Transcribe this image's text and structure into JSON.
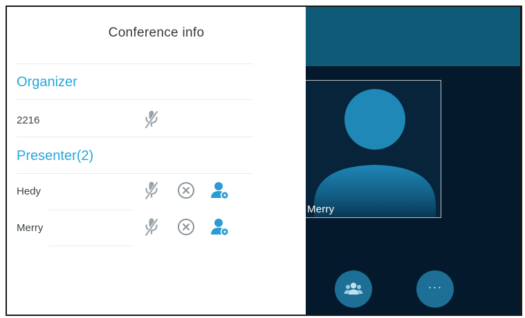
{
  "panel": {
    "title": "Conference info",
    "sections": [
      {
        "header": "Organizer",
        "members": [
          {
            "name": "2216",
            "icons": [
              "mute-microphone-icon"
            ]
          }
        ]
      },
      {
        "header": "Presenter(2)",
        "members": [
          {
            "name": "Hedy",
            "icons": [
              "mute-microphone-icon",
              "remove-circle-icon",
              "presenter-settings-icon"
            ]
          },
          {
            "name": "Merry",
            "icons": [
              "mute-microphone-icon",
              "remove-circle-icon",
              "presenter-settings-icon"
            ]
          }
        ]
      }
    ]
  },
  "video": {
    "participant_name": "Merry",
    "buttons": [
      {
        "name": "participants",
        "icon": "people-group-icon"
      },
      {
        "name": "more",
        "icon": "more-dots-icon",
        "label": "···"
      }
    ]
  },
  "colors": {
    "accent": "#27a6da",
    "video_header": "#0e5a77",
    "video_background": "#041a2c",
    "round_button": "#1d6f96"
  }
}
